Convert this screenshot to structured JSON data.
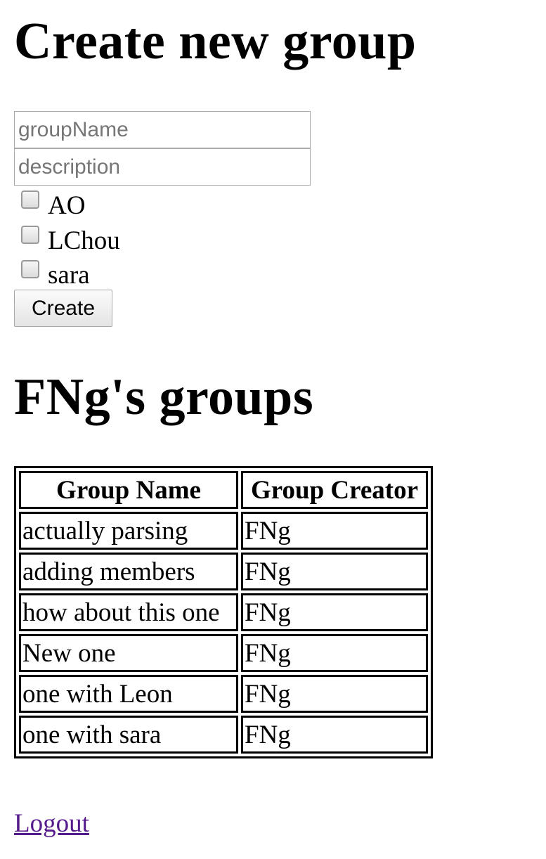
{
  "create_section": {
    "title": "Create new group",
    "group_name_placeholder": "groupName",
    "description_placeholder": "description",
    "members": [
      {
        "label": "AO",
        "checked": false
      },
      {
        "label": "LChou",
        "checked": false
      },
      {
        "label": "sara",
        "checked": false
      }
    ],
    "create_button": "Create"
  },
  "groups_section": {
    "title": "FNg's groups",
    "columns": [
      "Group Name",
      "Group Creator"
    ],
    "rows": [
      [
        "actually parsing",
        "FNg"
      ],
      [
        "adding members",
        "FNg"
      ],
      [
        "how about this one",
        "FNg"
      ],
      [
        "New one",
        "FNg"
      ],
      [
        "one with Leon",
        "FNg"
      ],
      [
        "one with sara",
        "FNg"
      ]
    ]
  },
  "logout_link": "Logout",
  "colors": {
    "visited_link": "#551a8b",
    "placeholder": "#767676",
    "input_border": "#a9a9a9"
  }
}
